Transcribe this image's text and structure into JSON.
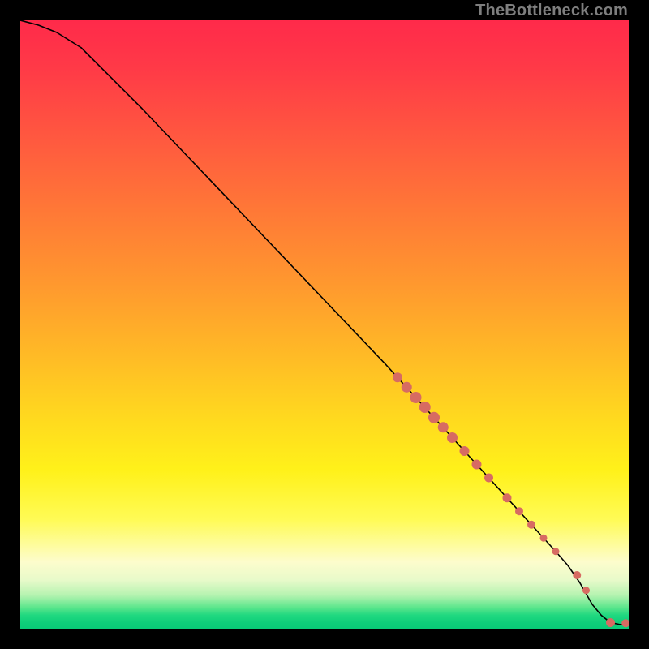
{
  "watermark": "TheBottleneck.com",
  "chart_data": {
    "type": "line",
    "title": "",
    "xlabel": "",
    "ylabel": "",
    "xlim": [
      0,
      100
    ],
    "ylim": [
      0,
      100
    ],
    "grid": false,
    "legend": false,
    "curve": {
      "x": [
        0,
        3,
        6,
        10,
        20,
        30,
        40,
        50,
        60,
        62,
        64,
        66,
        68,
        70,
        72,
        74,
        76,
        78,
        80,
        82,
        84,
        86,
        88,
        90,
        92,
        94,
        95.5,
        97,
        98.5,
        100
      ],
      "y": [
        100,
        99.2,
        98.0,
        95.5,
        85.5,
        75.0,
        64.5,
        54.0,
        43.5,
        41.3,
        39.1,
        36.9,
        34.7,
        32.5,
        30.3,
        28.1,
        25.9,
        23.7,
        21.5,
        19.3,
        17.1,
        14.9,
        12.7,
        10.4,
        7.5,
        4.0,
        2.2,
        1.0,
        0.7,
        0.7
      ]
    },
    "series": [
      {
        "name": "markers",
        "style": "point",
        "color": "#d76b62",
        "x": [
          62,
          63.5,
          65,
          66.5,
          68,
          69.5,
          71,
          73,
          75,
          77,
          80,
          82,
          84,
          86,
          88,
          91.5,
          93,
          97,
          99.5
        ],
        "y": [
          41.3,
          39.7,
          38.0,
          36.4,
          34.7,
          33.1,
          31.4,
          29.2,
          27.0,
          24.8,
          21.5,
          19.3,
          17.1,
          14.9,
          12.7,
          8.8,
          6.3,
          1.0,
          0.9
        ],
        "r": [
          6,
          6.5,
          7,
          7,
          7,
          6.5,
          6.5,
          6,
          6,
          5.5,
          5.5,
          5,
          5,
          4.5,
          4.5,
          5,
          4.5,
          5.5,
          5
        ]
      }
    ],
    "background_gradient": {
      "stops": [
        {
          "pos": 0.0,
          "color": "#ff2a4a"
        },
        {
          "pos": 0.35,
          "color": "#ff7a36"
        },
        {
          "pos": 0.65,
          "color": "#ffd81f"
        },
        {
          "pos": 0.86,
          "color": "#fdfccc"
        },
        {
          "pos": 0.97,
          "color": "#20d880"
        },
        {
          "pos": 1.0,
          "color": "#09cb77"
        }
      ]
    }
  }
}
